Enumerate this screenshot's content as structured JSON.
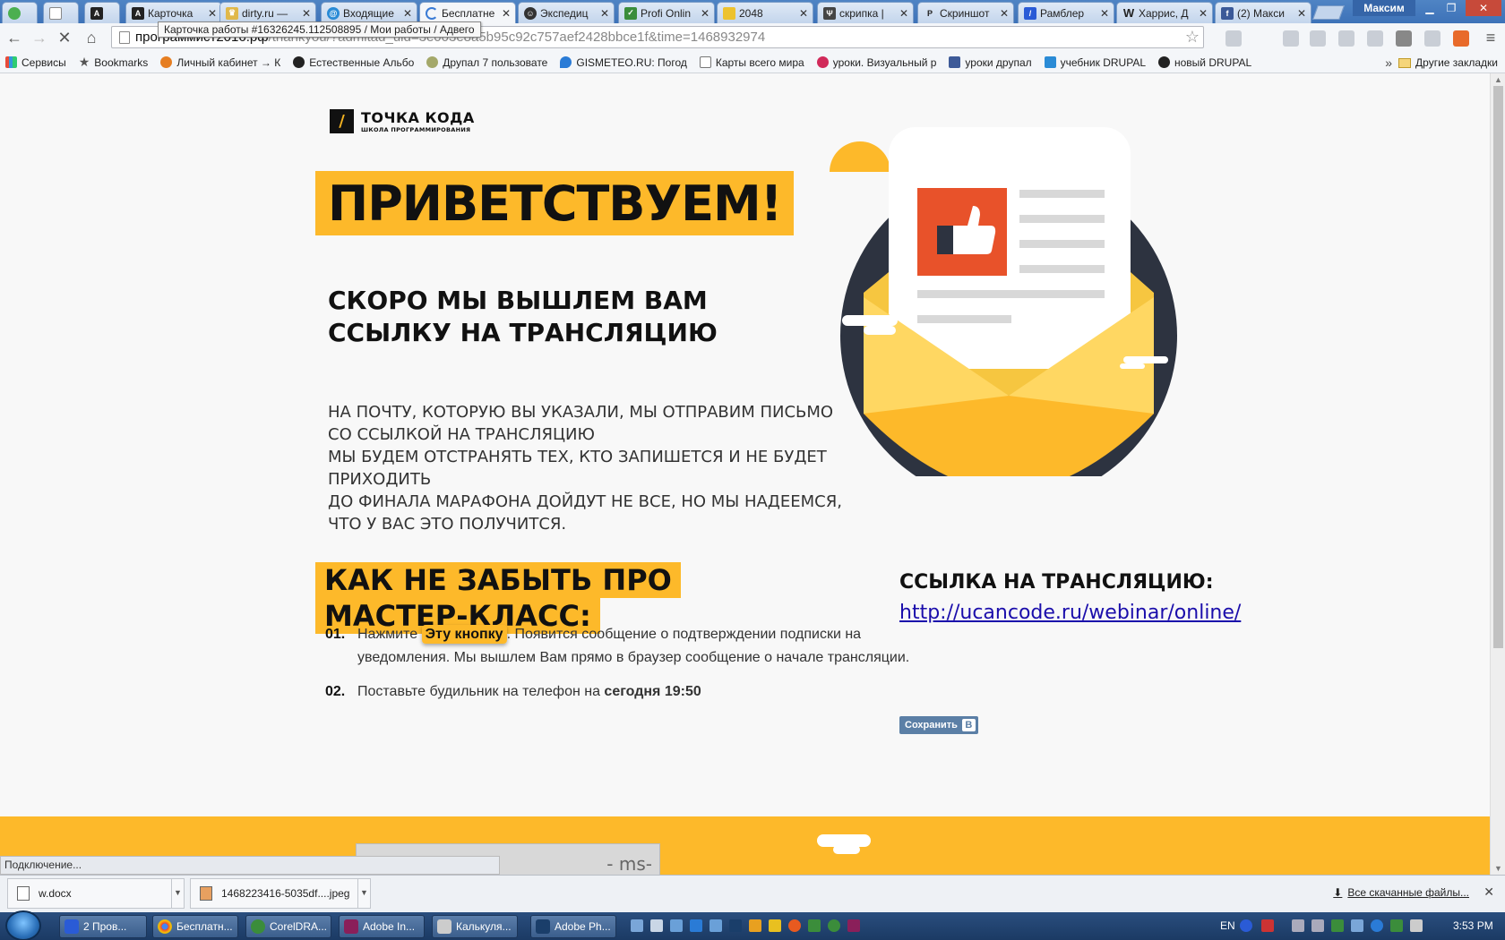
{
  "tabs": [
    {
      "title": "",
      "favicon": "green-circle-icon"
    },
    {
      "title": "",
      "favicon": "page-icon"
    },
    {
      "title": "",
      "favicon": "letter-a-icon"
    },
    {
      "title": "Карточка",
      "favicon": "letter-a-icon"
    },
    {
      "title": "dirty.ru —",
      "favicon": "crown-icon"
    },
    {
      "title": "Входящие",
      "favicon": "mail-ring-icon"
    },
    {
      "title": "Бесплатне",
      "favicon": "loading-spinner-icon"
    },
    {
      "title": "Экспедиц",
      "favicon": "mask-icon"
    },
    {
      "title": "Profi Onlin",
      "favicon": "checkmark-icon"
    },
    {
      "title": "2048",
      "favicon": "game-2048-icon"
    },
    {
      "title": "скрипка |",
      "favicon": "violin-icon"
    },
    {
      "title": "Скриншот",
      "favicon": "letter-p-icon"
    },
    {
      "title": "Рамблер",
      "favicon": "slash-icon"
    },
    {
      "title": "Харрис, Д",
      "favicon": "wikipedia-icon"
    },
    {
      "title": "(2) Макси",
      "favicon": "facebook-icon"
    }
  ],
  "window": {
    "profile_name": "Максим"
  },
  "tooltip": "Карточка работы #16326245.112508895 / Мои работы / Адвего",
  "address_bar": {
    "host": "программист2016.рф",
    "path": "/thankyou/?admitad_uid=3e003e8a5b95c92c757aef2428bbce1f&time=1468932974"
  },
  "bookmarks": [
    {
      "label": "Сервисы",
      "icon": "apps-grid-icon"
    },
    {
      "label": "Bookmarks",
      "icon": "star-icon"
    },
    {
      "label": "Личный кабинет → К",
      "icon": "people-icon"
    },
    {
      "label": "Естественные Альбо",
      "icon": "camera-icon"
    },
    {
      "label": "Друпал 7 пользовате",
      "icon": "gear-icon"
    },
    {
      "label": "GISMETEO.RU: Погод",
      "icon": "drop-icon"
    },
    {
      "label": "Карты всего мира",
      "icon": "page-icon"
    },
    {
      "label": "уроки. Визуальный р",
      "icon": "letter-f-icon"
    },
    {
      "label": "уроки друпал",
      "icon": "letter-s-icon"
    },
    {
      "label": "учебник DRUPAL",
      "icon": "dna-icon"
    },
    {
      "label": "новый DRUPAL",
      "icon": "github-icon"
    }
  ],
  "bookmarks_other": "Другие закладки",
  "page": {
    "logo_title": "ТОЧКА КОДА",
    "logo_subtitle": "ШКОЛА ПРОГРАММИРОВАНИЯ",
    "welcome": "ПРИВЕТСТВУЕМ!",
    "subhead_line1": "СКОРО МЫ ВЫШЛЕМ ВАМ",
    "subhead_line2": "ССЫЛКУ НА ТРАНСЛЯЦИЮ",
    "body_lines": [
      "НА ПОЧТУ, КОТОРУЮ ВЫ УКАЗАЛИ, МЫ ОТПРАВИМ ПИСЬМО",
      "СО ССЫЛКОЙ НА ТРАНСЛЯЦИЮ",
      "МЫ БУДЕМ ОТСТРАНЯТЬ ТЕХ, КТО ЗАПИШЕТСЯ И НЕ БУДЕТ",
      "ПРИХОДИТЬ",
      "ДО ФИНАЛА МАРАФОНА ДОЙДУТ НЕ ВСЕ, НО МЫ НАДЕЕМСЯ,",
      "ЧТО У ВАС ЭТО ПОЛУЧИТСЯ."
    ],
    "remind_line1": "КАК НЕ ЗАБЫТЬ ПРО",
    "remind_line2": "МАСТЕР-КЛАСС:",
    "step1_num": "01.",
    "step1_pre": "Нажмите ",
    "step1_button": "Эту кнопку",
    "step1_post": ". Появится сообщение о подтверждении подписки на уведомления. Мы вышлем Вам прямо в браузер сообщение о начале трансляции.",
    "step2_num": "02.",
    "step2_pre": "Поставьте будильник на телефон на ",
    "step2_bold": "сегодня 19:50",
    "stream_label": "ССЫЛКА НА ТРАНСЛЯЦИЮ:",
    "stream_url": "http://ucancode.ru/webinar/online/",
    "vk_save": "Сохранить",
    "vk_letter": "В",
    "footer_image_text": "- ms-"
  },
  "status_bar": "Подключение...",
  "downloads": [
    {
      "name": "w.docx"
    },
    {
      "name": "1468223416-5035df....jpeg"
    }
  ],
  "all_downloads": "Все скачанные файлы...",
  "taskbar": {
    "items": [
      {
        "label": "2 Пров..."
      },
      {
        "label": "Бесплатн..."
      },
      {
        "label": "CorelDRA..."
      },
      {
        "label": "Adobe In..."
      },
      {
        "label": "Калькуля..."
      },
      {
        "label": "Adobe Ph..."
      }
    ],
    "lang": "EN",
    "clock": "3:53 PM"
  },
  "colors": {
    "accent": "#fdb92a",
    "dark": "#111111",
    "link": "#1a0dab",
    "envelope_dark": "#2d3340",
    "thumb_red": "#e8522a"
  }
}
